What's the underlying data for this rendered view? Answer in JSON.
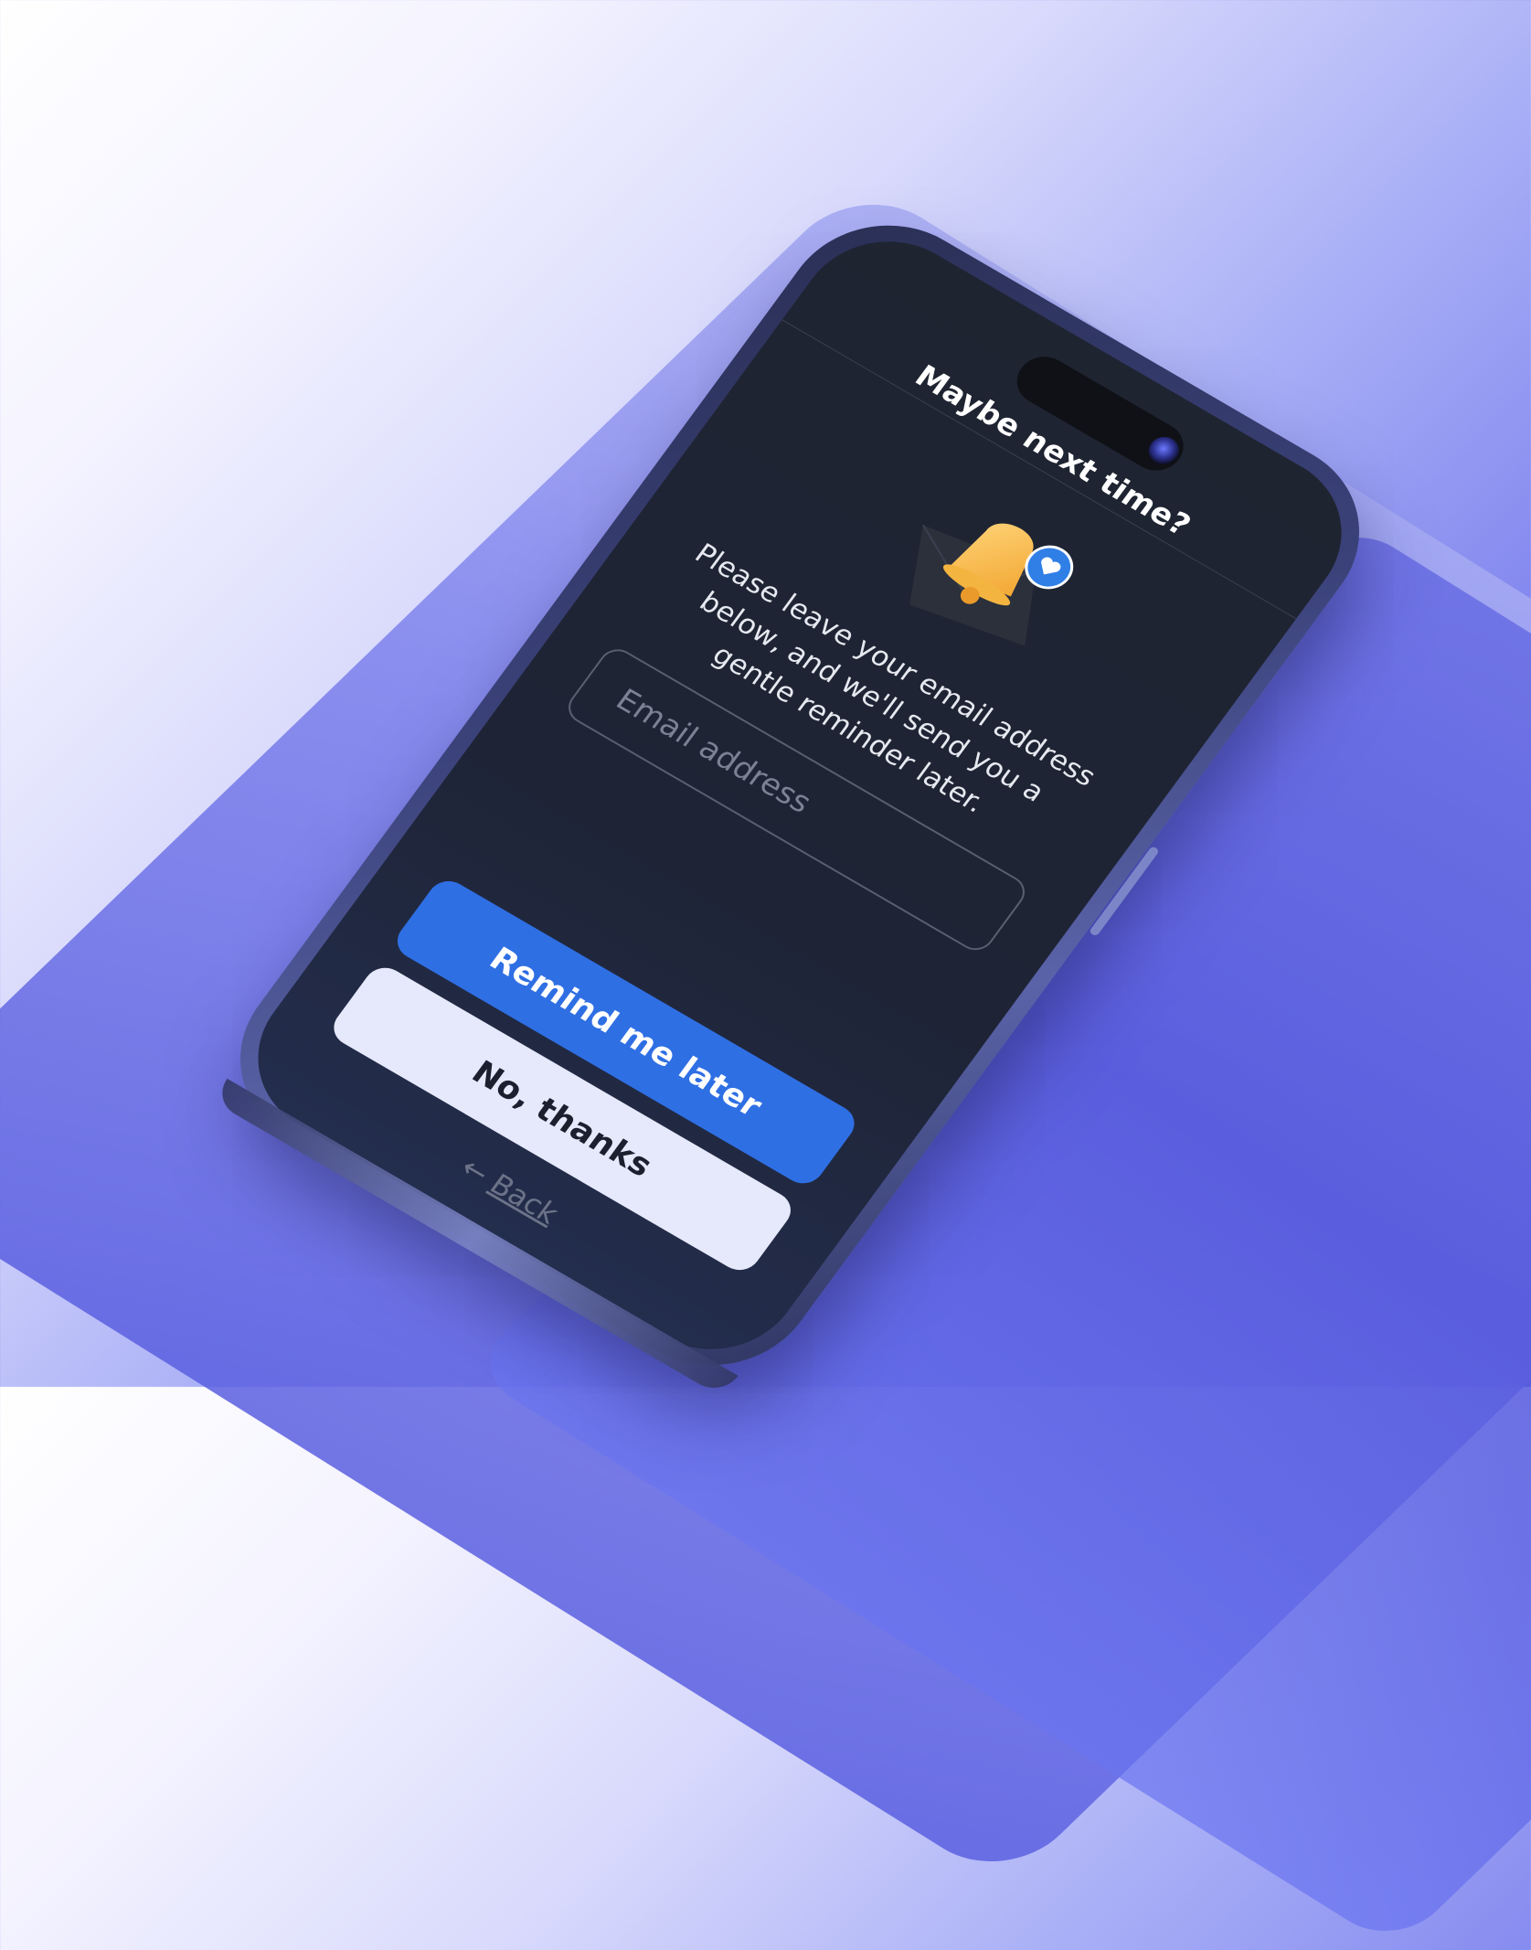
{
  "screen": {
    "title": "Maybe next time?",
    "message": "Please leave your email address below, and we'll send you a gentle reminder later.",
    "email_placeholder": "Email address",
    "remind_button": "Remind me later",
    "no_thanks_button": "No, thanks",
    "back_arrow": "←",
    "back_label": "Back"
  },
  "colors": {
    "primary_button": "#2f6fe4",
    "secondary_button": "#e6e9fb",
    "screen_background": "#1f2431"
  },
  "icons": [
    "bell-icon",
    "heart-badge-icon",
    "envelope-icon"
  ]
}
